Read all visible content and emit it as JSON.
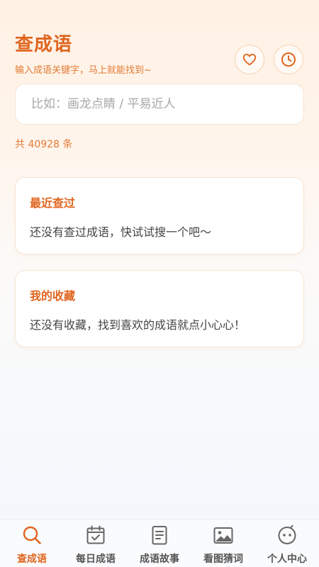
{
  "header": {
    "title": "查成语",
    "subtitle": "输入成语关键字，马上就能找到~",
    "favorite_icon": "heart-icon",
    "history_icon": "clock-icon"
  },
  "search": {
    "placeholder": "比如：画龙点睛 / 平易近人",
    "value": ""
  },
  "count_text": "共 40928 条",
  "recent": {
    "title": "最近查过",
    "empty_text": "还没有查过成语，快试试搜一个吧～"
  },
  "favorites": {
    "title": "我的收藏",
    "empty_text": "还没有收藏，找到喜欢的成语就点小心心！"
  },
  "tabbar": {
    "active_index": 0,
    "items": [
      {
        "label": "查成语",
        "icon": "search-icon"
      },
      {
        "label": "每日成语",
        "icon": "calendar-check-icon"
      },
      {
        "label": "成语故事",
        "icon": "book-icon"
      },
      {
        "label": "看图猜词",
        "icon": "image-icon"
      },
      {
        "label": "个人中心",
        "icon": "face-icon"
      }
    ]
  },
  "colors": {
    "accent": "#e0651f",
    "accent_light": "#e27a35",
    "tab_inactive": "#555555",
    "background_top": "#fff3e8"
  }
}
